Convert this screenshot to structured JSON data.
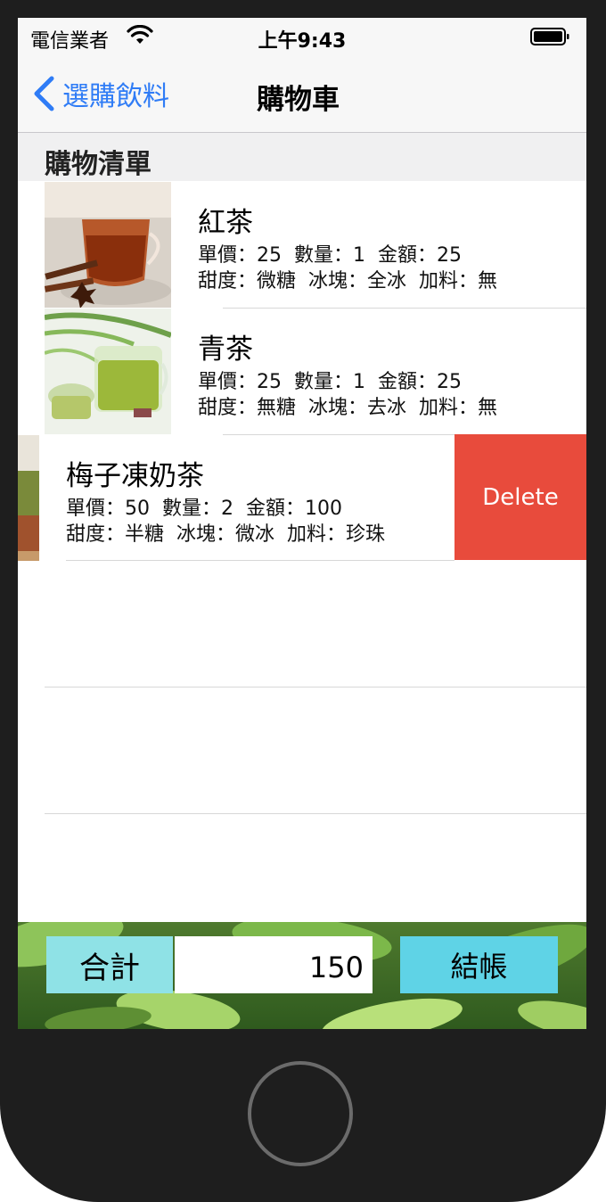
{
  "status_bar": {
    "carrier": "電信業者",
    "time": "上午9:43"
  },
  "nav": {
    "back_label": "選購飲料",
    "title": "購物車"
  },
  "section": {
    "title": "購物清單"
  },
  "cart_items": [
    {
      "name": "紅茶",
      "price_line": "單價：25  數量：1  金額：25",
      "options_line": "甜度：微糖  冰塊：全冰  加料：無"
    },
    {
      "name": "青茶",
      "price_line": "單價：25  數量：1  金額：25",
      "options_line": "甜度：無糖  冰塊：去冰  加料：無"
    },
    {
      "name": "梅子凍奶茶",
      "price_line": "單價：50  數量：2  金額：100",
      "options_line": "甜度：半糖  冰塊：微冰  加料：珍珠"
    }
  ],
  "delete_label": "Delete",
  "footer": {
    "total_label": "合計",
    "total_value": "150",
    "checkout_label": "結帳"
  },
  "colors": {
    "tint": "#2f7cf6",
    "delete": "#e84b3c",
    "total_label_bg": "#8fe2e6",
    "checkout_bg": "#5fd3e6"
  }
}
